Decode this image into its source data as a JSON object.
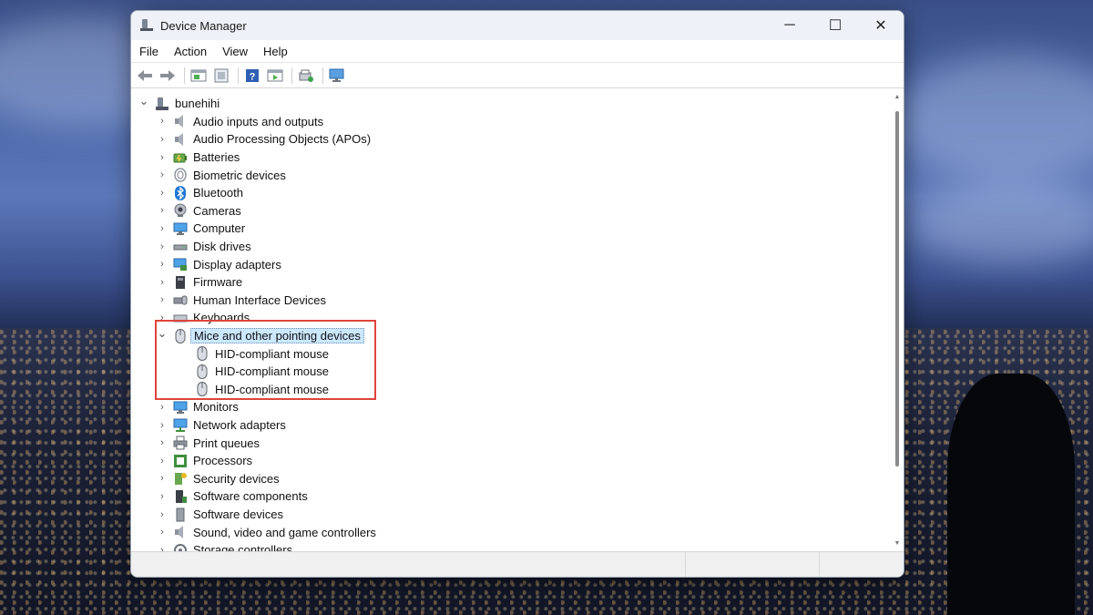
{
  "window": {
    "title": "Device Manager"
  },
  "controls": {
    "minimize": "─",
    "maximize": "☐",
    "close": "✕"
  },
  "menu": [
    "File",
    "Action",
    "View",
    "Help"
  ],
  "toolbar": [
    "back-icon",
    "forward-icon",
    "properties-icon",
    "update-driver-icon",
    "help-icon",
    "show-hidden-icon",
    "uninstall-icon",
    "scan-hardware-icon"
  ],
  "tree": {
    "root": "bunehihi",
    "categories": [
      {
        "label": "Audio inputs and outputs",
        "icon": "speaker-icon"
      },
      {
        "label": "Audio Processing Objects (APOs)",
        "icon": "speaker-icon"
      },
      {
        "label": "Batteries",
        "icon": "battery-icon"
      },
      {
        "label": "Biometric devices",
        "icon": "fingerprint-icon"
      },
      {
        "label": "Bluetooth",
        "icon": "bluetooth-icon"
      },
      {
        "label": "Cameras",
        "icon": "camera-icon"
      },
      {
        "label": "Computer",
        "icon": "monitor-icon"
      },
      {
        "label": "Disk drives",
        "icon": "disk-icon"
      },
      {
        "label": "Display adapters",
        "icon": "display-adapter-icon"
      },
      {
        "label": "Firmware",
        "icon": "firmware-icon"
      },
      {
        "label": "Human Interface Devices",
        "icon": "hid-icon"
      },
      {
        "label": "Keyboards",
        "icon": "keyboard-icon"
      },
      {
        "label": "Mice and other pointing devices",
        "icon": "mouse-icon",
        "expanded": true,
        "selected": true,
        "children": [
          "HID-compliant mouse",
          "HID-compliant mouse",
          "HID-compliant mouse"
        ]
      },
      {
        "label": "Monitors",
        "icon": "monitor-icon"
      },
      {
        "label": "Network adapters",
        "icon": "network-icon"
      },
      {
        "label": "Print queues",
        "icon": "printer-icon"
      },
      {
        "label": "Processors",
        "icon": "processor-icon"
      },
      {
        "label": "Security devices",
        "icon": "security-icon"
      },
      {
        "label": "Software components",
        "icon": "software-component-icon"
      },
      {
        "label": "Software devices",
        "icon": "software-device-icon"
      },
      {
        "label": "Sound, video and game controllers",
        "icon": "speaker-icon"
      },
      {
        "label": "Storage controllers",
        "icon": "storage-icon"
      }
    ]
  },
  "colors": {
    "highlight_box": "#e0443a",
    "selection": "#cce8ff"
  }
}
